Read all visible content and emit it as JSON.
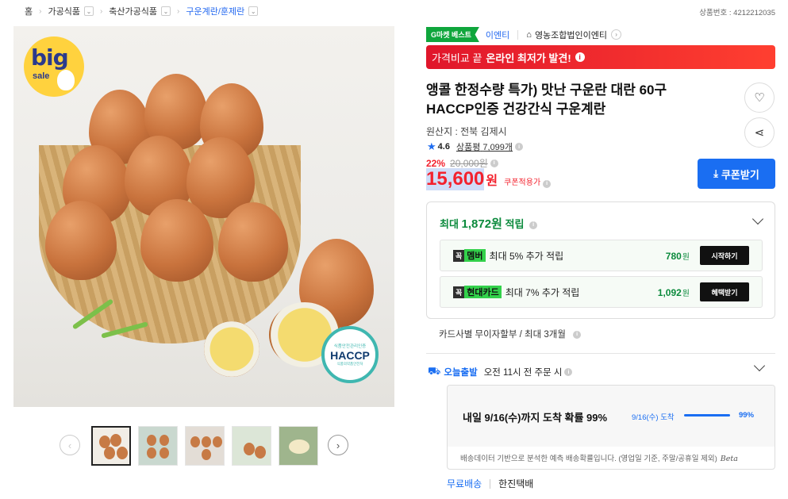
{
  "breadcrumb": {
    "items": [
      {
        "label": "홈",
        "has_dropdown": false
      },
      {
        "label": "가공식품",
        "has_dropdown": true
      },
      {
        "label": "축산가공식품",
        "has_dropdown": true
      },
      {
        "label": "구운계란/훈제란",
        "has_dropdown": true,
        "active": true
      }
    ]
  },
  "product_no": "상품번호 : 4212212035",
  "image": {
    "badge_big": "big",
    "badge_sale": "sale",
    "haccp_top": "식품안전관리인증",
    "haccp_main": "HACCP",
    "haccp_bottom": "식품의약품안전처"
  },
  "gallery": {
    "thumbnail_count": 5,
    "active_index": 0,
    "prev_icon": "chevron-left-icon",
    "next_icon": "chevron-right-icon"
  },
  "badges": {
    "gmarket_best": "G마켓 베스트",
    "brand": "이엔티",
    "seller": "영농조합법인이엔티"
  },
  "price_banner": {
    "prefix": "가격비교 끝",
    "emphasis": "온라인 최저가 발견!"
  },
  "product": {
    "title": "앵콜 한정수량 특가) 맛난 구운란 대란 60구 HACCP인증 건강간식 구운계란",
    "origin": "원산지 : 전북 김제시",
    "rating": "4.6",
    "review_label": "상품평",
    "review_count": "7,099개",
    "discount": "22%",
    "original_price": "20,000원",
    "price": "15,600",
    "price_unit": "원",
    "coupon_applied": "쿠폰적용가",
    "coupon_button": "쿠폰받기"
  },
  "rewards": {
    "head_prefix": "최대",
    "head_amount": "1,872원",
    "head_suffix": "적립",
    "items": [
      {
        "kkok": "꼭",
        "name": "멤버",
        "desc": "최대 5% 추가 적립",
        "amount": "780",
        "unit": "원",
        "action": "시작하기"
      },
      {
        "kkok": "꼭",
        "name": "현대카드",
        "desc": "최대 7% 추가 적립",
        "amount": "1,092",
        "unit": "원",
        "action": "혜택받기"
      }
    ]
  },
  "installment": "카드사별 무이자할부 / 최대 3개월",
  "shipping": {
    "today_label": "오늘출발",
    "cutoff": "오전 11시 전 주문 시",
    "arrive_main": "내일 9/16(수)까지 도착 확률 99%",
    "arrive_date": "9/16(수) 도착",
    "arrive_pct": "99%",
    "arrive_probability": 0.99,
    "note": "배송데이터 기반으로 분석한 예측 배송확률입니다. (영업일 기준, 주말/공휴일 제외)",
    "beta": "Beta",
    "free": "무료배송",
    "carrier": "한진택배"
  },
  "colors": {
    "accent_blue": "#1a6ef2",
    "discount_red": "#f3222e",
    "reward_green": "#0b8a3c",
    "best_green": "#0fa63c"
  }
}
